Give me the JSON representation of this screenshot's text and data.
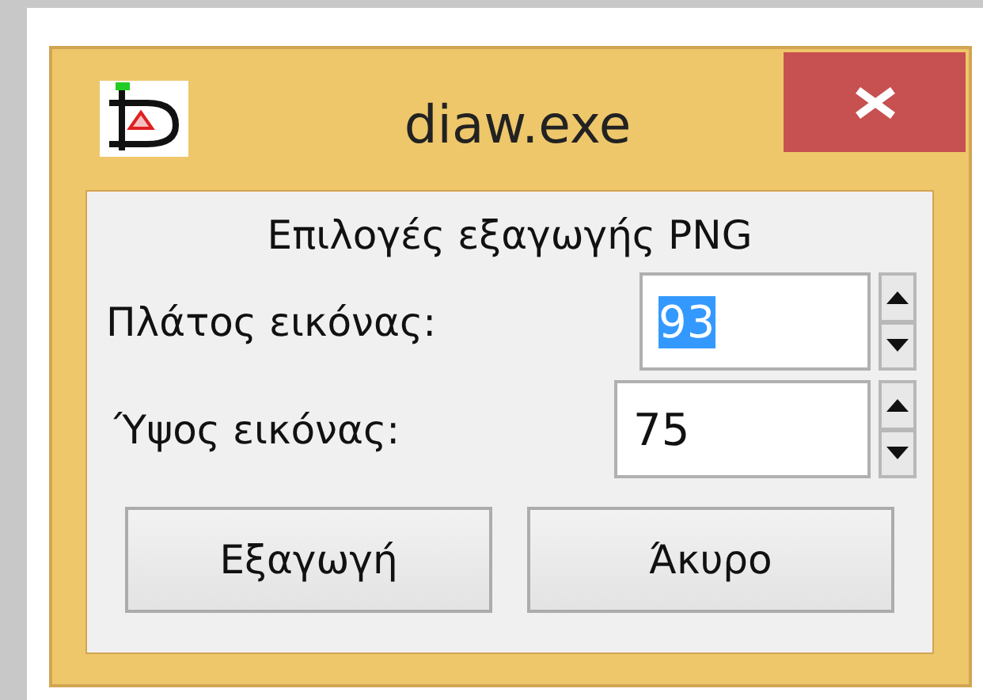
{
  "window": {
    "title": "diaw.exe"
  },
  "heading": "Επιλογές εξαγωγής PNG",
  "fields": [
    {
      "label": "Πλάτος εικόνας:",
      "value": "93",
      "selected": true
    },
    {
      "label": "Ύψος εικόνας:",
      "value": "75",
      "selected": false
    }
  ],
  "buttons": [
    "Εξαγωγή",
    "Άκυρο"
  ]
}
